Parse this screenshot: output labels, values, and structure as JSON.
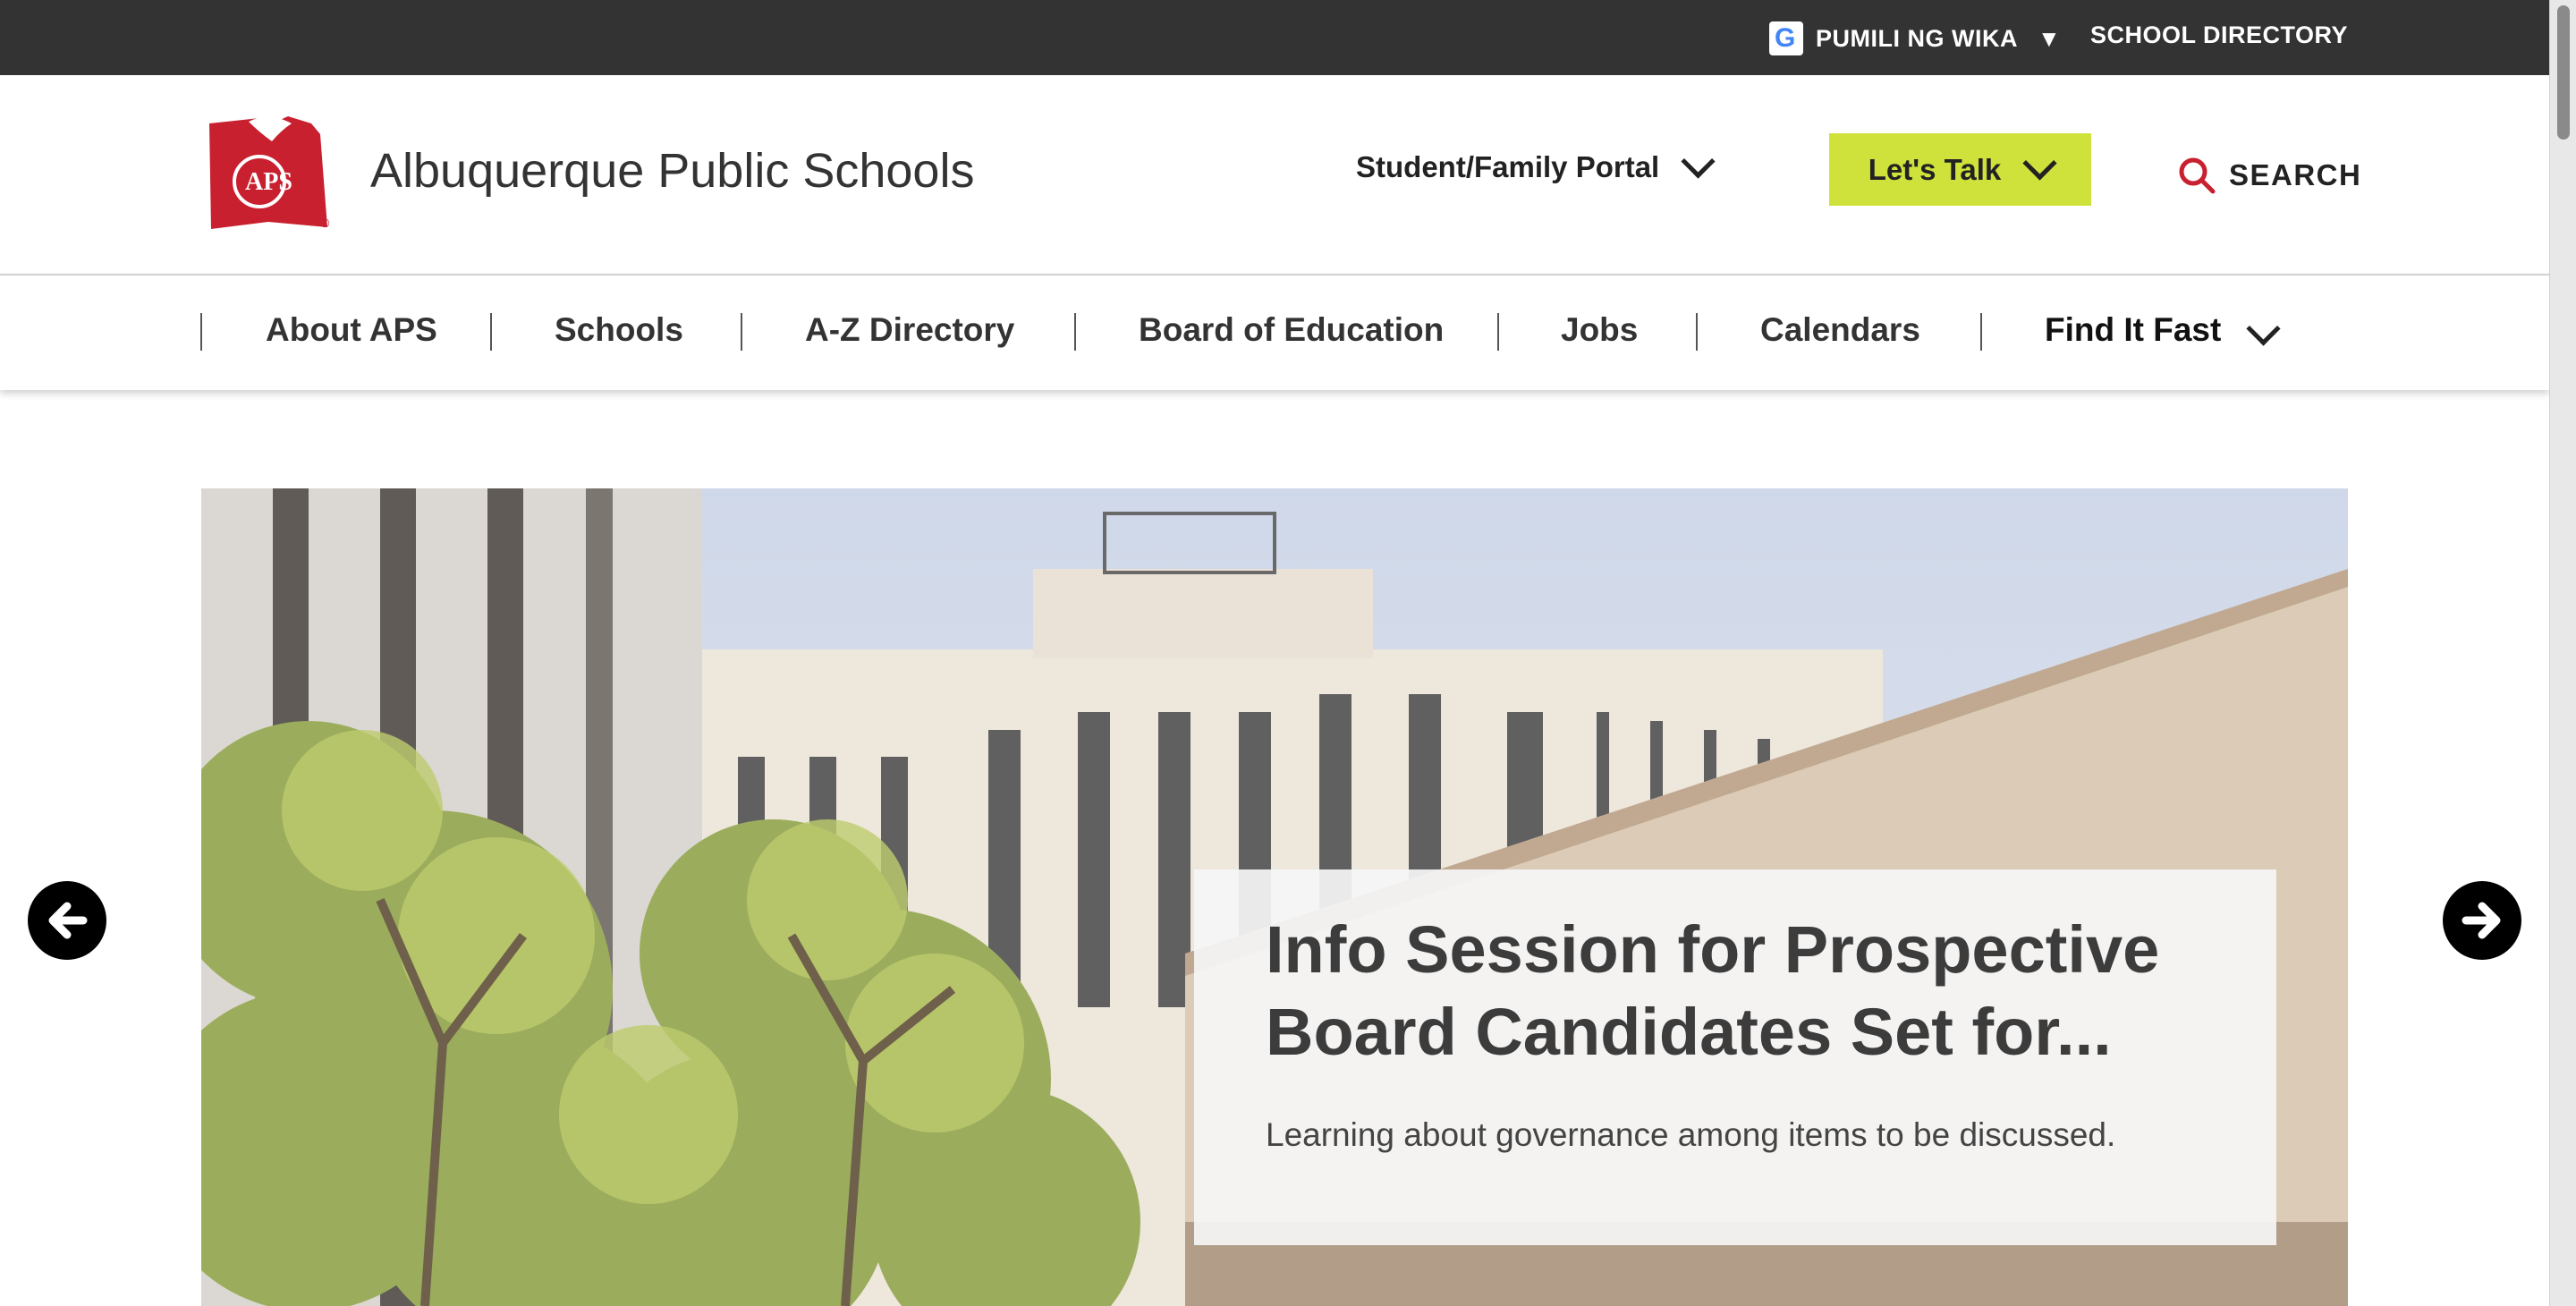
{
  "topbar": {
    "language_label": "PUMILI NG WIKA",
    "language_caret": "▼",
    "directory_link": "SCHOOL DIRECTORY"
  },
  "header": {
    "logo_text": "APS",
    "site_title": "Albuquerque Public Schools",
    "portal_label": "Student/Family Portal",
    "talk_label": "Let's Talk",
    "search_label": "SEARCH"
  },
  "nav": {
    "items": [
      {
        "label": "About APS"
      },
      {
        "label": "Schools"
      },
      {
        "label": "A-Z Directory"
      },
      {
        "label": "Board of Education"
      },
      {
        "label": "Jobs"
      },
      {
        "label": "Calendars"
      },
      {
        "label": "Find It Fast"
      }
    ]
  },
  "hero": {
    "title": "Info Session for Prospective Board Candidates Set for...",
    "text": "Learning about governance among items to be discussed."
  },
  "colors": {
    "topbar": "#333333",
    "accent_lime": "#cfe13b",
    "brand_red": "#c8202f"
  }
}
